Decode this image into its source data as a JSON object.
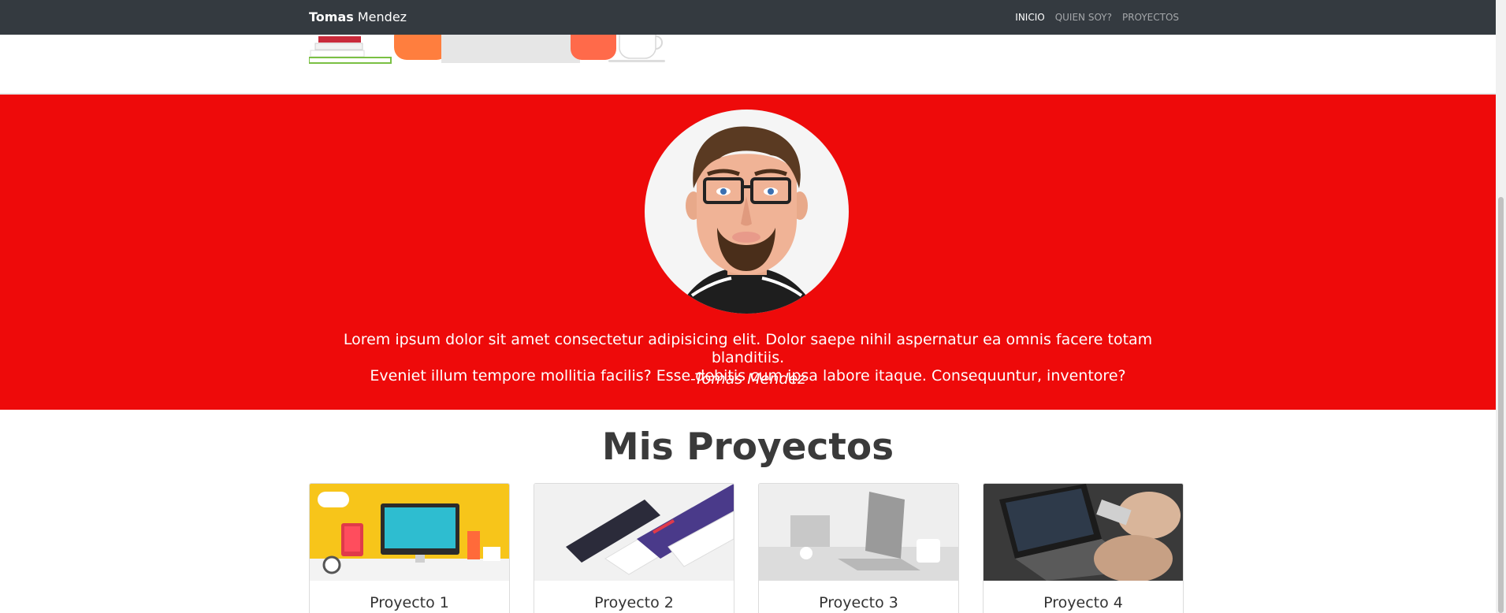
{
  "navbar": {
    "brand_bold": "Tomas",
    "brand_rest": " Mendez",
    "links": [
      {
        "label": "INICIO"
      },
      {
        "label": "QUIEN SOY?"
      },
      {
        "label": "PROYECTOS"
      }
    ]
  },
  "about": {
    "quote_line1": "Lorem ipsum dolor sit amet consectetur adipisicing elit. Dolor saepe nihil aspernatur ea omnis facere totam blanditiis.",
    "quote_line2": "Eveniet illum tempore mollitia facilis? Esse debitis cum ipsa labore itaque. Consequuntur, inventore?",
    "author": "-Tomas Mendez"
  },
  "projects": {
    "title": "Mis Proyectos",
    "cards": [
      {
        "title": "Proyecto 1"
      },
      {
        "title": "Proyecto 2"
      },
      {
        "title": "Proyecto 3"
      },
      {
        "title": "Proyecto 4"
      }
    ]
  },
  "colors": {
    "navbar": "#343a40",
    "about_band": "#ee0a0a"
  }
}
